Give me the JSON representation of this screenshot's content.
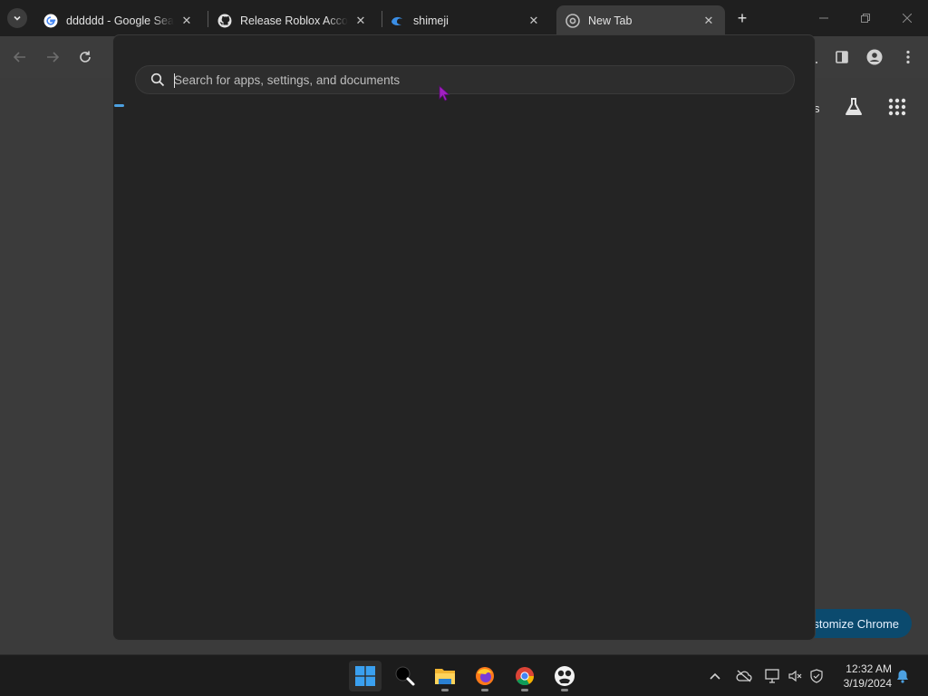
{
  "browser": {
    "tabs": [
      {
        "title": "dddddd - Google Search",
        "favicon": "google-icon",
        "active": false
      },
      {
        "title": "Release Roblox Account Manager",
        "favicon": "github-icon",
        "active": false
      },
      {
        "title": "shimeji",
        "favicon": "edge-app-icon",
        "active": false
      },
      {
        "title": "New Tab",
        "favicon": "chrome-icon",
        "active": true
      }
    ],
    "page_link_fragment": "s",
    "customize_label": "stomize Chrome"
  },
  "start_search": {
    "placeholder": "Search for apps, settings, and documents",
    "value": ""
  },
  "taskbar": {
    "apps": [
      "windows-start-icon",
      "search-app-icon",
      "file-explorer-icon",
      "firefox-icon",
      "chrome-icon",
      "pet-app-icon"
    ],
    "clock": {
      "time": "12:32 AM",
      "date": "3/19/2024"
    }
  },
  "colors": {
    "accent": "#4ca0e0",
    "customize_bg": "#0b4a6e"
  }
}
